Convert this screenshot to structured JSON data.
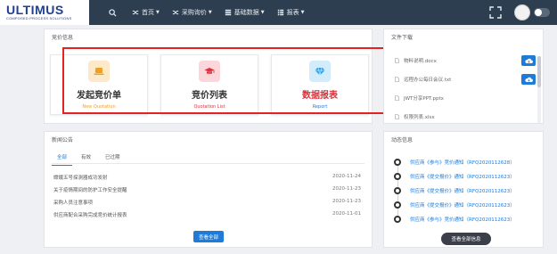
{
  "app": {
    "logo_main": "ULTIMUS",
    "logo_sub": "COMPOSED PROCESS SOLUTIONS"
  },
  "nav": {
    "items": [
      {
        "label": "首页",
        "icon": "shuffle-icon"
      },
      {
        "label": "采购询价",
        "icon": "shuffle-icon"
      },
      {
        "label": "基础数据",
        "icon": "database-icon"
      },
      {
        "label": "报表",
        "icon": "list-icon"
      }
    ],
    "search_icon": "search-icon"
  },
  "price_info": {
    "title": "竞价信息",
    "cards": [
      {
        "title": "发起竞价单",
        "subtitle": "New Quotation",
        "title_color": "#333333",
        "sub_color": "#f0a020",
        "icon_bg": "#fbe9c9",
        "icon_color": "#f0a020",
        "icon": "laptop-icon"
      },
      {
        "title": "竞价列表",
        "subtitle": "Quotation List",
        "title_color": "#333333",
        "sub_color": "#e0303a",
        "icon_bg": "#fbd7dc",
        "icon_color": "#e0303a",
        "icon": "graduation-cap-icon"
      },
      {
        "title": "数据报表",
        "subtitle": "Report",
        "title_color": "#e0303a",
        "sub_color": "#1f7bd8",
        "icon_bg": "#d3ecfb",
        "icon_color": "#2aa3e8",
        "icon": "diamond-icon"
      }
    ]
  },
  "files": {
    "title": "文件下载",
    "items": [
      {
        "name": "物料说明.docx"
      },
      {
        "name": "远程办公每日会议.txt"
      },
      {
        "name": "JWT分享PPT.pptx"
      },
      {
        "name": "权限列表.xlsx"
      }
    ]
  },
  "news": {
    "title": "新闻公告",
    "tabs": [
      "全部",
      "有效",
      "已过期"
    ],
    "rows": [
      {
        "title": "嫦娥五号探测器成功发射",
        "date": "2020-11-24"
      },
      {
        "title": "关于疫情期间的防护工作安全提醒",
        "date": "2020-11-23"
      },
      {
        "title": "采购人员注意事项",
        "date": "2020-11-23"
      },
      {
        "title": "供应商配合采购完成竞价统计报表",
        "date": "2020-11-01"
      }
    ],
    "view_all": "查看全部"
  },
  "activity": {
    "title": "动态信息",
    "items": [
      "供应商《参与》竞价通知（RFQ2020112628）",
      "供应商《提交报价》通知（RFQ2020112623）",
      "供应商《提交报价》通知（RFQ2020112623）",
      "供应商《提交报价》通知（RFQ2020112623）",
      "供应商《参与》竞价通知（RFQ2020112623）"
    ],
    "view_all": "查看全部信息"
  },
  "colors": {
    "nav_bg": "#2c3e50",
    "accent": "#1f7bd8",
    "highlight_border": "#e52222"
  }
}
